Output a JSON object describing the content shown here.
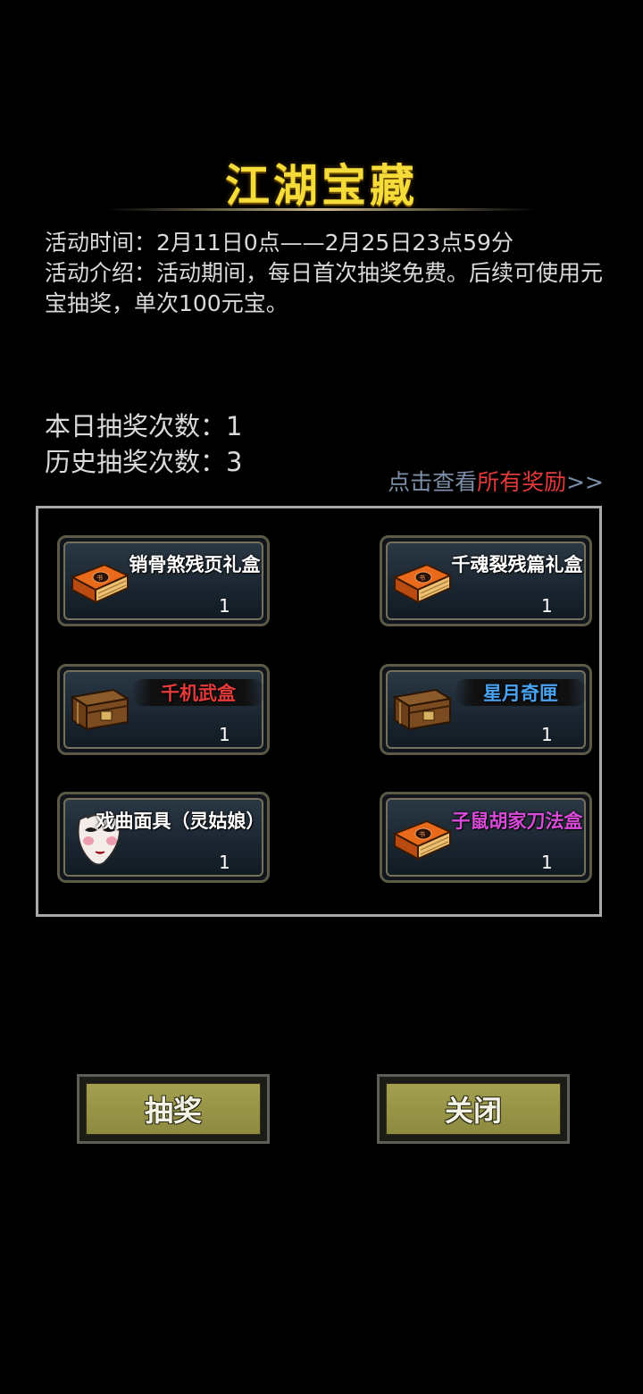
{
  "title": "江湖宝藏",
  "info": {
    "time": "活动时间：2月11日0点——2月25日23点59分",
    "desc": "活动介绍：活动期间，每日首次抽奖免费。后续可使用元宝抽奖，单次100元宝。"
  },
  "counts": {
    "today": "本日抽奖次数：1",
    "history": "历史抽奖次数：3"
  },
  "view_all": {
    "pre": "点击查看",
    "mid": "所有奖励",
    "post": ">>"
  },
  "rewards": [
    {
      "name": "销骨煞残页礼盒",
      "qty": "1",
      "icon": "book-box-icon",
      "name_color": "#ffffff"
    },
    {
      "name": "千魂裂残篇礼盒",
      "qty": "1",
      "icon": "book-box-icon",
      "name_color": "#ffffff"
    },
    {
      "name": "千机武盒",
      "qty": "1",
      "icon": "wooden-chest-icon",
      "name_color": "#e53a3a"
    },
    {
      "name": "星月奇匣",
      "qty": "1",
      "icon": "wooden-chest-icon",
      "name_color": "#4aa3f0"
    },
    {
      "name": "戏曲面具（灵姑娘）",
      "qty": "1",
      "icon": "opera-mask-icon",
      "name_color": "#ffffff"
    },
    {
      "name": "子鼠胡家刀法盒",
      "qty": "1",
      "icon": "book-box-icon",
      "name_color": "#d94bd9"
    }
  ],
  "buttons": {
    "draw": "抽奖",
    "close": "关闭"
  }
}
